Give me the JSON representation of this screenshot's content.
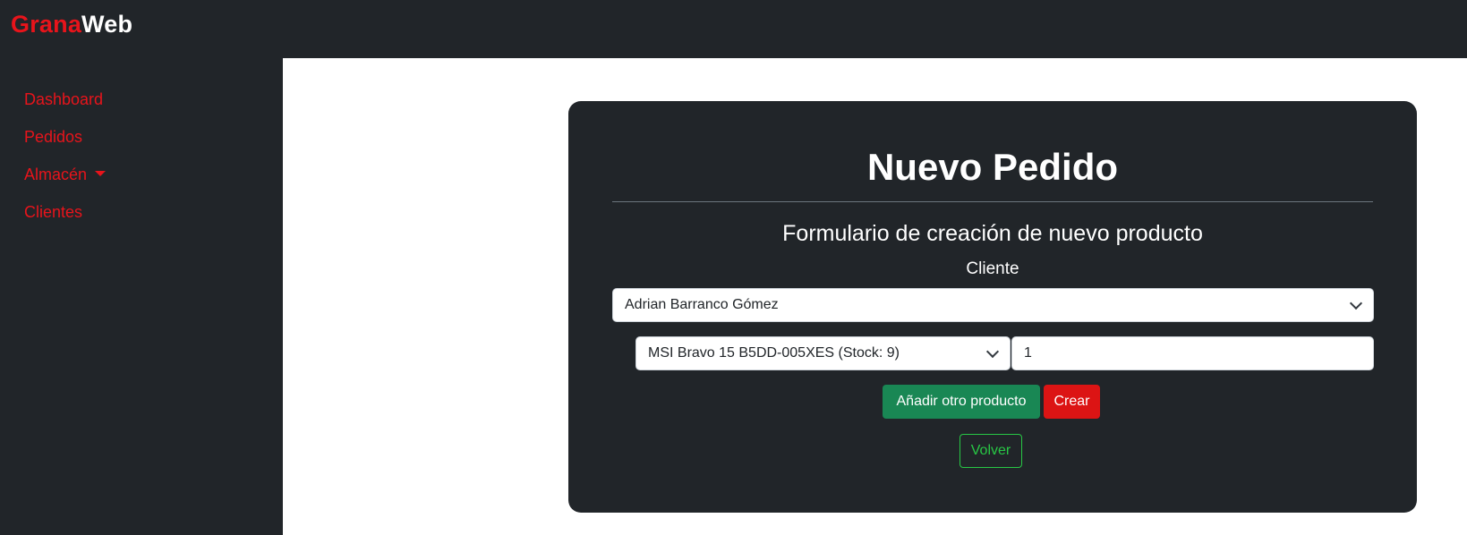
{
  "brand": {
    "part1": "Grana",
    "part2": "Web"
  },
  "sidebar": {
    "items": [
      {
        "label": "Dashboard"
      },
      {
        "label": "Pedidos"
      },
      {
        "label": "Almacén",
        "has_dropdown": true
      },
      {
        "label": "Clientes"
      }
    ]
  },
  "form": {
    "title": "Nuevo Pedido",
    "subtitle": "Formulario de creación de nuevo producto",
    "cliente_label": "Cliente",
    "cliente_selected": "Adrian Barranco Gómez",
    "producto_selected": "MSI Bravo 15 B5DD-005XES (Stock: 9)",
    "cantidad_value": "1",
    "add_button": "Añadir otro producto",
    "create_button": "Crear",
    "back_button": "Volver"
  },
  "colors": {
    "dark": "#212529",
    "brand_red": "#e8141b",
    "success": "#198754",
    "danger": "#dc1414",
    "outline_green": "#28c745"
  },
  "icons": {
    "select_arrow": "chevron-down-icon",
    "dropdown_caret": "caret-down-icon"
  }
}
